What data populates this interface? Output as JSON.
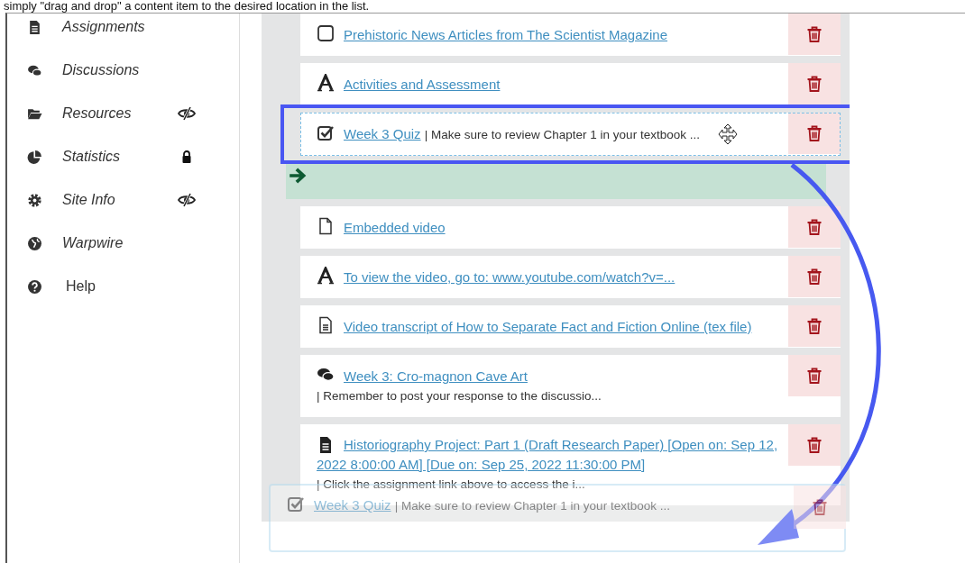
{
  "caption": "simply \"drag and drop\" a content item to the desired location in the list.",
  "sidebar": {
    "items": [
      {
        "kind": "assignments",
        "label": "Assignments",
        "italic": true,
        "hidden": false,
        "locked": false
      },
      {
        "kind": "discussions",
        "label": "Discussions",
        "italic": true,
        "hidden": false,
        "locked": false
      },
      {
        "kind": "resources",
        "label": "Resources",
        "italic": true,
        "hidden": true,
        "locked": false
      },
      {
        "kind": "statistics",
        "label": "Statistics",
        "italic": true,
        "hidden": false,
        "locked": true
      },
      {
        "kind": "settings",
        "label": "Site Info",
        "italic": true,
        "hidden": true,
        "locked": false
      },
      {
        "kind": "globe",
        "label": "Warpwire",
        "italic": true,
        "hidden": false,
        "locked": false
      },
      {
        "kind": "help",
        "label": "Help",
        "italic": false,
        "hidden": false,
        "locked": false
      }
    ]
  },
  "content": {
    "items": [
      {
        "kind": "link",
        "title": "Prehistoric News Articles from The Scientist Magazine",
        "selected": false
      },
      {
        "kind": "text",
        "title": "Activities and Assessment",
        "selected": false
      },
      {
        "kind": "quiz",
        "title": "Week 3 Quiz",
        "note": "| Make sure to review Chapter 1 in your textbook ...",
        "selected": true
      },
      {
        "kind": "drop"
      },
      {
        "kind": "page",
        "title": "Embedded video",
        "selected": false
      },
      {
        "kind": "text",
        "title": "To view the video, go to: www.youtube.com/watch?v=...",
        "selected": false
      },
      {
        "kind": "file",
        "title": "Video transcript of How to Separate Fact and Fiction Online (tex file)",
        "selected": false
      },
      {
        "kind": "discussion",
        "title": "Week 3: Cro-magnon Cave Art",
        "note": "| Remember to post your response to the discussio...",
        "selected": false
      },
      {
        "kind": "assignment",
        "title": "Historiography Project: Part 1 (Draft Research Paper) [Open on: Sep 12, 2022 8:00:00 AM] [Due on: Sep 25, 2022 11:30:00 PM]",
        "note": "| Click the assignment link above to access the i...",
        "selected": false
      }
    ]
  },
  "drag_ghost": {
    "kind": "quiz",
    "title": "Week 3 Quiz",
    "note": "| Make sure to review Chapter 1 in your textbook ..."
  }
}
